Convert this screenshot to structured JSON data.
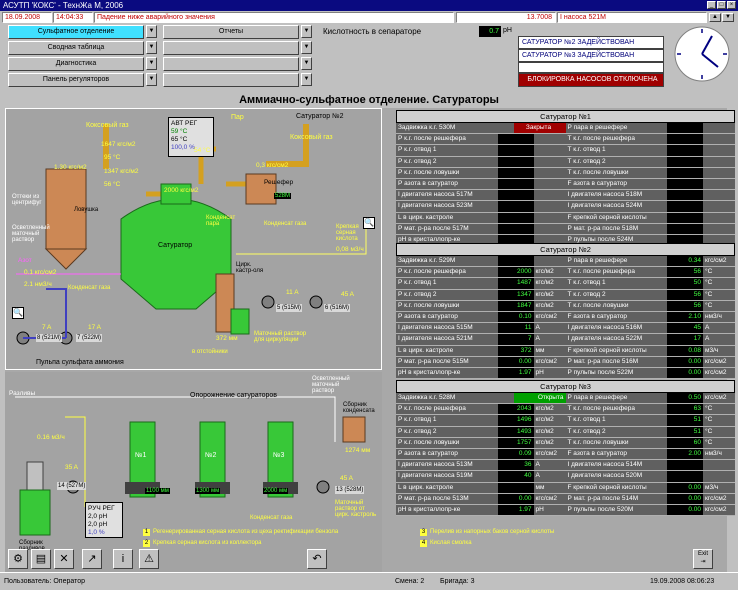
{
  "window": {
    "title": "АСУТП 'КОКС' - ТехнЖа М, 2006"
  },
  "alarm_bar": {
    "date": "18.09.2008",
    "time": "14:04:33",
    "message": "Падение ниже аварийного значения",
    "code": "13.7008",
    "text": "I насоса 521M"
  },
  "nav": {
    "left": [
      "Сульфатное отделение",
      "Сводная таблица",
      "Диагностика",
      "Панель регуляторов"
    ],
    "middle": [
      "Отчеты",
      "",
      "",
      ""
    ],
    "active_index": 0
  },
  "acidity": {
    "label": "Кислотность в сепараторе",
    "value": "0.7",
    "unit": "pH"
  },
  "status_panel": {
    "lines": [
      "САТУРАТОР №2 ЗАДЕЙСТВОВАН",
      "САТУРАТОР №3 ЗАДЕЙСТВОВАН",
      ""
    ],
    "alert": "БЛОКИРОВКА НАСОСОВ ОТКЛЮЧЕНА"
  },
  "page_title": "Аммиачно-сульфатное отделение. Сатураторы",
  "diagram": {
    "saturator_label": "Сатуратор №2",
    "coke_gas": "Коксовый газ",
    "coke_gas2": "Коксовый газ",
    "par": "Пар",
    "avt_reg": "АВТ РЕГ",
    "avt_val1": "59",
    "avt_val2": "65",
    "avt_val3": "100,0",
    "deg": "°C",
    "pct": "%",
    "press1": "1647 кгс/м2",
    "press2": "1.30 кгс/м2",
    "temp1": "95 °C",
    "temp2": "1347 кгс/м2",
    "temp3": "56 °C",
    "press_top": "2000 кгс/м2",
    "press_res": "0,3 кгс/см2",
    "degs": "54 °C",
    "otteki": "Оттеки из центрифуг",
    "lovushka": "Ловушка",
    "oset": "Осветленный маточный раствор",
    "resher": "Решефер",
    "resher_id": "528M",
    "kondensat_para": "Конденсат пара",
    "kondensat_gaza": "Конденсат газа",
    "saturator": "Сатуратор",
    "krepkaya": "Крепкая серная кислота",
    "kislota_flow": "0,08 м3/ч",
    "azot": "Азот",
    "azot_press": "0.1 кгс/см2",
    "azot_flow": "2.1 нм3/ч",
    "kond_gaza2": "Конденсат газа",
    "tsirk": "Цирк. кастр-оля",
    "pump5": "5 (515M)",
    "pump6": "6 (516M)",
    "amp1": "11 A",
    "amp2": "45 A",
    "level1": "372 мм",
    "matoch": "Маточный раствор для циркуляции",
    "v_otst": "в отстойники",
    "pump8": "8 (521M)",
    "pump7": "7 (522M)",
    "amp3": "7 A",
    "amp4": "17 A",
    "pulpa": "Пульпа сульфата аммония"
  },
  "diagram_bottom": {
    "razvy": "Разливы",
    "oporozh": "Опорожнение сатураторов",
    "oset": "Осветленный маточный раствор",
    "sbornik_kond": "Сборник конденсата",
    "kond_level": "1274 мм",
    "flow1": "0.16 м3/ч",
    "amp": "35 A",
    "pump14": "14 (527M)",
    "ruch_reg": "РУЧ РЕГ",
    "ph_val": "2,0 pH",
    "ph_val2": "2,0 pH",
    "pct_val": "1,0 %",
    "sbornik_razv": "Сборник разливов",
    "lvl1": "1100 мм",
    "lvl2": "1300 мм",
    "lvl3": "2000 мм",
    "kond_gaza": "Конденсат газа",
    "pump13": "13 (528M)",
    "amp13": "45 A",
    "matoch_ot": "Маточный раствор от цирк. кастроль",
    "sat1": "№1",
    "sat2": "№2",
    "sat3": "№3"
  },
  "legend": [
    {
      "n": "1",
      "t": "Регенерированная серная кислота из цеха ректификации бензола"
    },
    {
      "n": "2",
      "t": "Крепкая серная кислота из коллектора"
    },
    {
      "n": "3",
      "t": "Перелив из напорных баков серной кислоты"
    },
    {
      "n": "4",
      "t": "Кислая смолка"
    }
  ],
  "tables": [
    {
      "title": "Сатуратор №1",
      "rows": [
        [
          [
            "Задвижка к.г. 530M",
            "Закрыта",
            "",
            "closed"
          ],
          [
            "Р пара в решефере",
            "",
            "",
            ""
          ]
        ],
        [
          [
            "Р к.г. после решефера",
            "",
            "",
            ""
          ],
          [
            "Т к.г. после решефера",
            "",
            "",
            ""
          ]
        ],
        [
          [
            "Р к.г. отвод 1",
            "",
            "",
            ""
          ],
          [
            "Т к.г. отвод 1",
            "",
            "",
            ""
          ]
        ],
        [
          [
            "Р к.г. отвод 2",
            "",
            "",
            ""
          ],
          [
            "Т к.г. отвод 2",
            "",
            "",
            ""
          ]
        ],
        [
          [
            "Р к.г. после ловушки",
            "",
            "",
            ""
          ],
          [
            "Т к.г. после ловушки",
            "",
            "",
            ""
          ]
        ],
        [
          [
            "Р азота в сатуратор",
            "",
            "",
            ""
          ],
          [
            "F азота в сатуратор",
            "",
            "",
            ""
          ]
        ],
        [
          [
            "I двигателя насоса 517M",
            "",
            "",
            ""
          ],
          [
            "I двигателя насоса 518M",
            "",
            "",
            ""
          ]
        ],
        [
          [
            "I двигателя насоса 523M",
            "",
            "",
            ""
          ],
          [
            "I двигателя насоса 524M",
            "",
            "",
            ""
          ]
        ],
        [
          [
            "L в цирк. кастроле",
            "",
            "",
            ""
          ],
          [
            "F крепкой серной кислоты",
            "",
            "",
            ""
          ]
        ],
        [
          [
            "Р мат. р-ра после 517M",
            "",
            "",
            ""
          ],
          [
            "Р мат. р-ра после 518M",
            "",
            "",
            ""
          ]
        ],
        [
          [
            "рН в кристаллопр-ке",
            "",
            "",
            ""
          ],
          [
            "Р пульпы после 524M",
            "",
            "",
            ""
          ]
        ]
      ]
    },
    {
      "title": "Сатуратор №2",
      "rows": [
        [
          [
            "Задвижка к.г. 529M",
            "",
            "",
            ""
          ],
          [
            "Р пара в решефере",
            "0.34",
            "кгс/см2",
            ""
          ]
        ],
        [
          [
            "Р к.г. после решефера",
            "2000",
            "кгс/м2",
            ""
          ],
          [
            "Т к.г. после решефера",
            "56",
            "°С",
            ""
          ]
        ],
        [
          [
            "Р к.г. отвод 1",
            "1487",
            "кгс/м2",
            ""
          ],
          [
            "Т к.г. отвод 1",
            "50",
            "°С",
            ""
          ]
        ],
        [
          [
            "Р к.г. отвод 2",
            "1347",
            "кгс/м2",
            ""
          ],
          [
            "Т к.г. отвод 2",
            "56",
            "°С",
            ""
          ]
        ],
        [
          [
            "Р к.г. после ловушки",
            "1847",
            "кгс/м2",
            ""
          ],
          [
            "Т к.г. после ловушки",
            "56",
            "°С",
            ""
          ]
        ],
        [
          [
            "Р азота в сатуратор",
            "0.10",
            "кгс/см2",
            ""
          ],
          [
            "F азота в сатуратор",
            "2.10",
            "нм3/ч",
            ""
          ]
        ],
        [
          [
            "I двигателя насоса 515M",
            "11",
            "A",
            ""
          ],
          [
            "I двигателя насоса 516M",
            "45",
            "A",
            ""
          ]
        ],
        [
          [
            "I двигателя насоса 521M",
            "7",
            "A",
            ""
          ],
          [
            "I двигателя насоса 522M",
            "17",
            "A",
            ""
          ]
        ],
        [
          [
            "L в цирк. кастроле",
            "372",
            "мм",
            ""
          ],
          [
            "F крепкой серной кислоты",
            "0.08",
            "м3/ч",
            ""
          ]
        ],
        [
          [
            "Р мат. р-ра после 515M",
            "0.00",
            "кгс/см2",
            ""
          ],
          [
            "Р мат. р-ра после 516M",
            "0.00",
            "кгс/см2",
            ""
          ]
        ],
        [
          [
            "рН в кристаллопр-ке",
            "1.97",
            "pH",
            ""
          ],
          [
            "Р пульпы после 522M",
            "0.00",
            "кгс/см2",
            ""
          ]
        ]
      ]
    },
    {
      "title": "Сатуратор №3",
      "rows": [
        [
          [
            "Задвижка к.г. 528M",
            "Открыта",
            "",
            "opened"
          ],
          [
            "Р пара в решефере",
            "0.50",
            "кгс/см2",
            ""
          ]
        ],
        [
          [
            "Р к.г. после решефера",
            "2043",
            "кгс/м2",
            ""
          ],
          [
            "Т к.г. после решефера",
            "63",
            "°С",
            ""
          ]
        ],
        [
          [
            "Р к.г. отвод 1",
            "1496",
            "кгс/м2",
            ""
          ],
          [
            "Т к.г. отвод 1",
            "51",
            "°С",
            ""
          ]
        ],
        [
          [
            "Р к.г. отвод 2",
            "1493",
            "кгс/м2",
            ""
          ],
          [
            "Т к.г. отвод 2",
            "51",
            "°С",
            ""
          ]
        ],
        [
          [
            "Р к.г. после ловушки",
            "1757",
            "кгс/м2",
            ""
          ],
          [
            "Т к.г. после ловушки",
            "60",
            "°С",
            ""
          ]
        ],
        [
          [
            "Р азота в сатуратор",
            "0.09",
            "кгс/см2",
            ""
          ],
          [
            "F азота в сатуратор",
            "2.00",
            "нм3/ч",
            ""
          ]
        ],
        [
          [
            "I двигателя насоса 513M",
            "36",
            "A",
            ""
          ],
          [
            "I двигателя насоса 514M",
            "",
            "",
            ""
          ]
        ],
        [
          [
            "I двигателя насоса 519M",
            "40",
            "A",
            ""
          ],
          [
            "I двигателя насоса 520M",
            "",
            "",
            ""
          ]
        ],
        [
          [
            "L в цирк. кастроле",
            "",
            "мм",
            ""
          ],
          [
            "F крепкой серной кислоты",
            "0.00",
            "м3/ч",
            ""
          ]
        ],
        [
          [
            "Р мат. р-ра после 513M",
            "0.00",
            "кгс/см2",
            ""
          ],
          [
            "Р мат. р-ра после 514M",
            "0.00",
            "кгс/см2",
            ""
          ]
        ],
        [
          [
            "рН в кристаллопр-ке",
            "1.97",
            "pH",
            ""
          ],
          [
            "Р пульпы после 520M",
            "0.00",
            "кгс/см2",
            ""
          ]
        ]
      ]
    }
  ],
  "toolbar": {
    "exit_label": "Exit"
  },
  "statusbar": {
    "user_label": "Пользователь:",
    "user": "Оператор",
    "shift_label": "Смена:",
    "shift": "2",
    "brigade_label": "Бригада:",
    "brigade": "3",
    "datetime": "19.09.2008  08:06:23"
  },
  "colors": {
    "accent": "#40e0ff",
    "green_vessel": "#38c838",
    "alarm_red": "#a00000",
    "value_green": "#40ff40"
  }
}
